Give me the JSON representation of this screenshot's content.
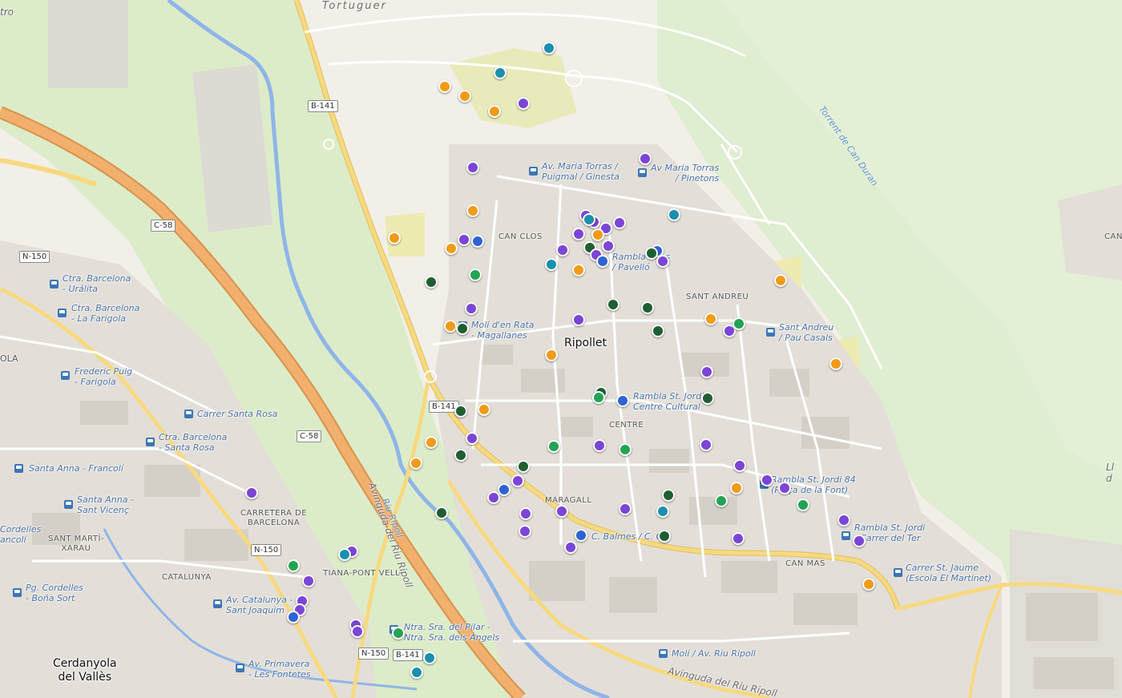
{
  "map": {
    "towns": [
      {
        "name": "Ripollet"
      },
      {
        "name": "Cerdanyola\ndel Vallès"
      }
    ],
    "districts": [
      {
        "name": "CAN CLOS"
      },
      {
        "name": "SANT ANDREU"
      },
      {
        "name": "CENTRE"
      },
      {
        "name": "MARAGALL"
      },
      {
        "name": "CAN MAS"
      },
      {
        "name": "CARRETERA DE\nBARCELONA"
      },
      {
        "name": "CATALUNYA"
      },
      {
        "name": "TIANA-PONT VELL"
      },
      {
        "name": "SANT MARTÍ-\nXARAU"
      },
      {
        "name": "CAN"
      }
    ],
    "bus_stops": [
      {
        "name": "Av. Maria Torras /\nPuigmal / Ginesta"
      },
      {
        "name": "Av Maria Torras\n/ Pinetons"
      },
      {
        "name": "Rambla ... ns\n/ Pavelló"
      },
      {
        "name": "Molí d'en Rata\n- Magallanes"
      },
      {
        "name": "Sant Andreu\n/ Pau Casals"
      },
      {
        "name": "Rambla St. Jordi\nCentre Cultural"
      },
      {
        "name": "Rambla St. Jordi 84\n(Plaça de la Font)"
      },
      {
        "name": "Rambla St. Jordi\n/ Carrer del Ter"
      },
      {
        "name": "Carrer St. Jaume\n(Escola El Martinet)"
      },
      {
        "name": "C. Balmes / C. C..."
      },
      {
        "name": "Molí / Av. Riu Ripoll"
      },
      {
        "name": "Ntra. Sra. del Pilar -\nNtra. Sra. dels Àngels"
      },
      {
        "name": "Av. Primavera\n- Les Fontetes"
      },
      {
        "name": "Av. Catalunya -\nSant Joaquim"
      },
      {
        "name": "Pg. Cordelles\n- Boña Sort"
      },
      {
        "name": "Santa Anna -\nSant Vicenç"
      },
      {
        "name": "Santa Anna - Francolí"
      },
      {
        "name": "Ctra. Barcelona\n- Santa Rosa"
      },
      {
        "name": "Carrer Santa Rosa"
      },
      {
        "name": "Frederic Puig\n- Farigola"
      },
      {
        "name": "Ctra. Barcelona\n- La Farigola"
      },
      {
        "name": "Ctra. Barcelona\n- Urálita"
      },
      {
        "name": "Cordelles\nancolí"
      }
    ],
    "roads": [
      {
        "name": "Tortuguer"
      },
      {
        "name": "Avinguda del Riu Ripoll"
      },
      {
        "name": "Avinguda del Riu Ripoll"
      },
      {
        "name": "Torrent de Can Duran"
      },
      {
        "name": "Riu Ripoll"
      },
      {
        "name": "OLA"
      },
      {
        "name": "tro"
      },
      {
        "name": "Ll\nd"
      }
    ],
    "shields": [
      {
        "name": "B-141"
      },
      {
        "name": "B-141"
      },
      {
        "name": "B-141"
      },
      {
        "name": "C-58"
      },
      {
        "name": "C-58"
      },
      {
        "name": "N-150"
      },
      {
        "name": "N-150"
      },
      {
        "name": "N-150"
      }
    ],
    "colors": {
      "orange": "#f29b18",
      "purple": "#7b45d6",
      "blue": "#2e63d4",
      "teal": "#1b8fad",
      "green": "#24a354",
      "dark_green": "#1f5e32",
      "motorway": "#e9a35a",
      "primary": "#f7d97f",
      "river": "#8fb5e8",
      "park": "#d9ebc6"
    }
  }
}
